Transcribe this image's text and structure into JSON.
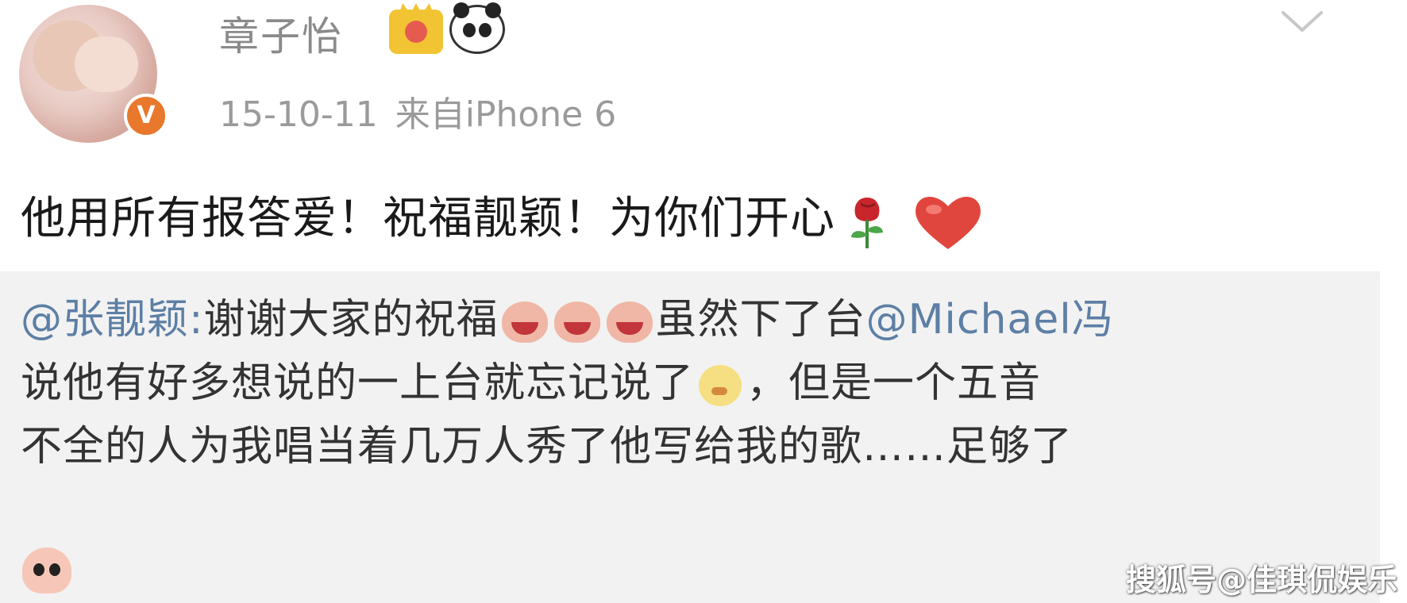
{
  "post": {
    "username": "章子怡",
    "date": "15-10-11",
    "source": "来自iPhone 6",
    "text": "他用所有报答爱！祝福靓颖！为你们开心",
    "emojis": [
      "rose-icon",
      "heart-icon"
    ]
  },
  "repost": {
    "line1": {
      "mention": "@张靓颖:",
      "text_a": "谢谢大家的祝福",
      "text_b": "虽然下了台",
      "mention2": "@Michael冯"
    },
    "line2": {
      "text_a": "说他有好多想说的一上台就忘记说了",
      "text_b": "，但是一个五音"
    },
    "line3": "不全的人为我唱当着几万人秀了他写给我的歌……足够了"
  },
  "watermark": "搜狐号@佳琪侃娱乐",
  "colors": {
    "mention": "#5d7fa5",
    "repost_bg": "#f2f2f2",
    "meta": "#9a9a9a",
    "verified": "#e8782b"
  }
}
